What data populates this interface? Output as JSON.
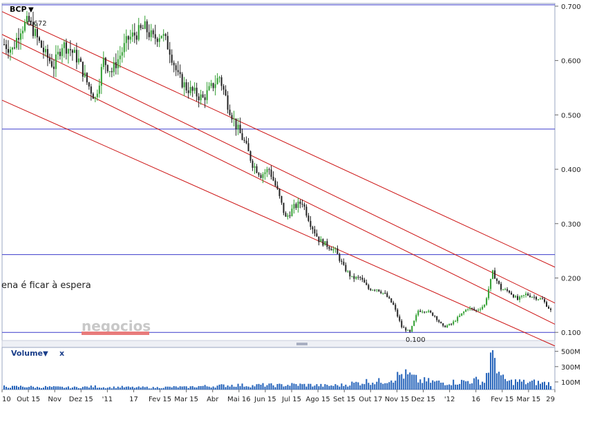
{
  "chart_data": [
    {
      "type": "candlestick",
      "symbol": "BCP",
      "symbol_menu": "▼",
      "overlay_text": "ena é ficar à espera",
      "watermark": "negocios",
      "annotations": [
        {
          "label": "0.672",
          "value": 0.672,
          "x": "Out 15"
        },
        {
          "label": "0.100",
          "value": 0.1,
          "x": "Nov 15"
        }
      ],
      "ylim": [
        0.085,
        0.705
      ],
      "yticks": [
        {
          "value": 0.7,
          "label": "0.700"
        },
        {
          "value": 0.6,
          "label": "0.600"
        },
        {
          "value": 0.5,
          "label": "0.500"
        },
        {
          "value": 0.4,
          "label": "0.400"
        },
        {
          "value": 0.3,
          "label": "0.300"
        },
        {
          "value": 0.2,
          "label": "0.200"
        },
        {
          "value": 0.1,
          "label": "0.100"
        }
      ],
      "horizontal_lines": [
        0.474,
        0.243,
        0.1
      ],
      "horizontal_line_color": "#3a3acc",
      "trend_channel": [
        {
          "start": 0.69,
          "end": 0.22
        },
        {
          "start": 0.648,
          "end": 0.154
        },
        {
          "start": 0.615,
          "end": 0.115
        },
        {
          "start": 0.527,
          "end": 0.075
        }
      ],
      "trend_line_color": "#cc1010",
      "up_color": "#2e9e2e",
      "down_color": "#222222",
      "close_path": [
        0.63,
        0.62,
        0.66,
        0.672,
        0.64,
        0.61,
        0.59,
        0.63,
        0.62,
        0.6,
        0.56,
        0.53,
        0.6,
        0.58,
        0.61,
        0.64,
        0.65,
        0.66,
        0.64,
        0.65,
        0.62,
        0.57,
        0.55,
        0.54,
        0.53,
        0.55,
        0.57,
        0.52,
        0.48,
        0.45,
        0.41,
        0.39,
        0.4,
        0.36,
        0.31,
        0.33,
        0.34,
        0.3,
        0.27,
        0.26,
        0.25,
        0.22,
        0.2,
        0.2,
        0.18,
        0.18,
        0.17,
        0.15,
        0.11,
        0.1,
        0.14,
        0.14,
        0.13,
        0.11,
        0.115,
        0.13,
        0.145,
        0.14,
        0.15,
        0.21,
        0.18,
        0.175,
        0.16,
        0.17,
        0.165,
        0.16,
        0.14
      ]
    },
    {
      "type": "bar",
      "title": "Volume",
      "title_menu": "▼",
      "close_label": "x",
      "yticks": [
        {
          "value": 500,
          "label": "500M"
        },
        {
          "value": 300,
          "label": "300M"
        },
        {
          "value": 100,
          "label": "100M"
        }
      ],
      "ylim": [
        0,
        515
      ],
      "bar_color": "#1f5fb8",
      "volume_path": [
        40,
        35,
        40,
        38,
        30,
        35,
        32,
        30,
        28,
        30,
        35,
        40,
        30,
        28,
        35,
        30,
        28,
        30,
        25,
        30,
        32,
        35,
        30,
        40,
        45,
        42,
        50,
        55,
        60,
        55,
        50,
        60,
        58,
        55,
        60,
        65,
        62,
        60,
        55,
        50,
        55,
        60,
        80,
        90,
        110,
        100,
        120,
        150,
        200,
        180,
        120,
        110,
        100,
        90,
        95,
        100,
        110,
        120,
        100,
        510,
        150,
        100,
        110,
        90,
        95,
        85,
        80
      ]
    }
  ],
  "x_axis_labels": [
    "10",
    "Out 15",
    "Nov",
    "Dez 15",
    "'11",
    "17",
    "Fev 15",
    "Mar 15",
    "Abr",
    "Mai 16",
    "Jun 15",
    "Jul 15",
    "Ago 15",
    "Set 15",
    "Out 17",
    "Nov 15",
    "Dez 15",
    "'12",
    "16",
    "Fev 15",
    "Mar 15",
    "29"
  ]
}
